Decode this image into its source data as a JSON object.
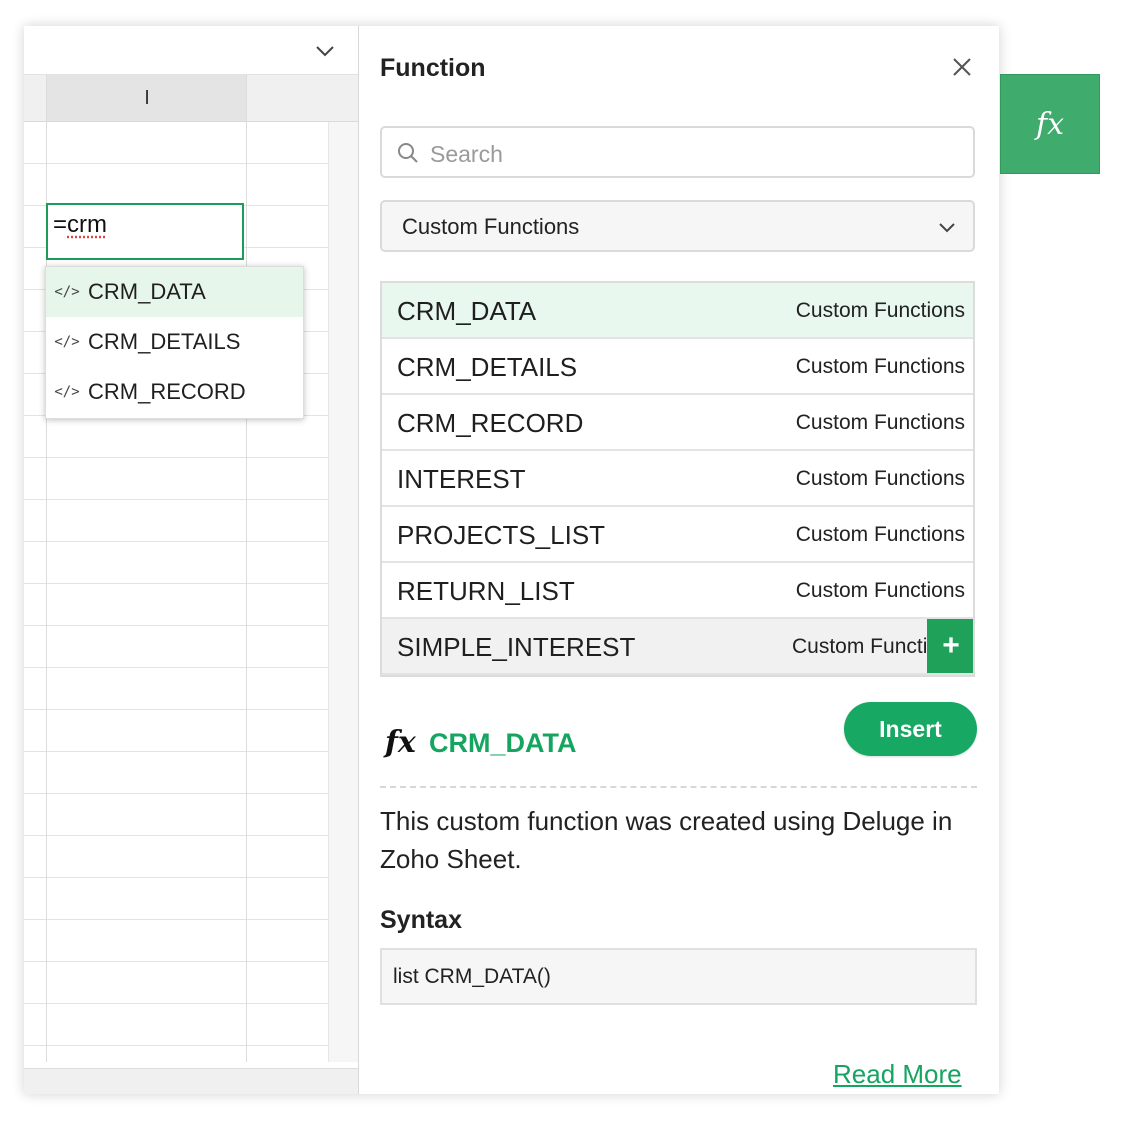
{
  "sheet": {
    "column_header": "I",
    "cell_editor_prefix": "=",
    "cell_editor_query": "crm",
    "autocomplete": [
      {
        "icon": "code-icon",
        "icon_glyph": "</>",
        "label": "CRM_DATA",
        "active": true
      },
      {
        "icon": "code-icon",
        "icon_glyph": "</>",
        "label": "CRM_DETAILS",
        "active": false
      },
      {
        "icon": "code-icon",
        "icon_glyph": "</>",
        "label": "CRM_RECORD",
        "active": false
      }
    ]
  },
  "panel": {
    "title": "Function",
    "close_icon": "close-icon",
    "search": {
      "placeholder": "Search",
      "value": ""
    },
    "category": {
      "selected": "Custom Functions"
    },
    "functions": [
      {
        "name": "CRM_DATA",
        "category": "Custom Functions",
        "state": "selected"
      },
      {
        "name": "CRM_DETAILS",
        "category": "Custom Functions",
        "state": ""
      },
      {
        "name": "CRM_RECORD",
        "category": "Custom Functions",
        "state": ""
      },
      {
        "name": "INTEREST",
        "category": "Custom Functions",
        "state": ""
      },
      {
        "name": "PROJECTS_LIST",
        "category": "Custom Functions",
        "state": ""
      },
      {
        "name": "RETURN_LIST",
        "category": "Custom Functions",
        "state": ""
      },
      {
        "name": "SIMPLE_INTEREST",
        "category": "Custom Functions",
        "state": "hovered"
      }
    ],
    "add_button_label": "+",
    "insert_label": "Insert",
    "fx_symbol": "fx",
    "selected_function": "CRM_DATA",
    "description": "This custom function was created using Deluge in Zoho Sheet.",
    "syntax_label": "Syntax",
    "syntax": "list CRM_DATA()",
    "read_more": "Read More"
  },
  "fx_tab": {
    "symbol": "fx"
  },
  "colors": {
    "accent": "#16a461",
    "selected_row": "#e8f8ee",
    "fx_tab": "#3fab6d"
  }
}
